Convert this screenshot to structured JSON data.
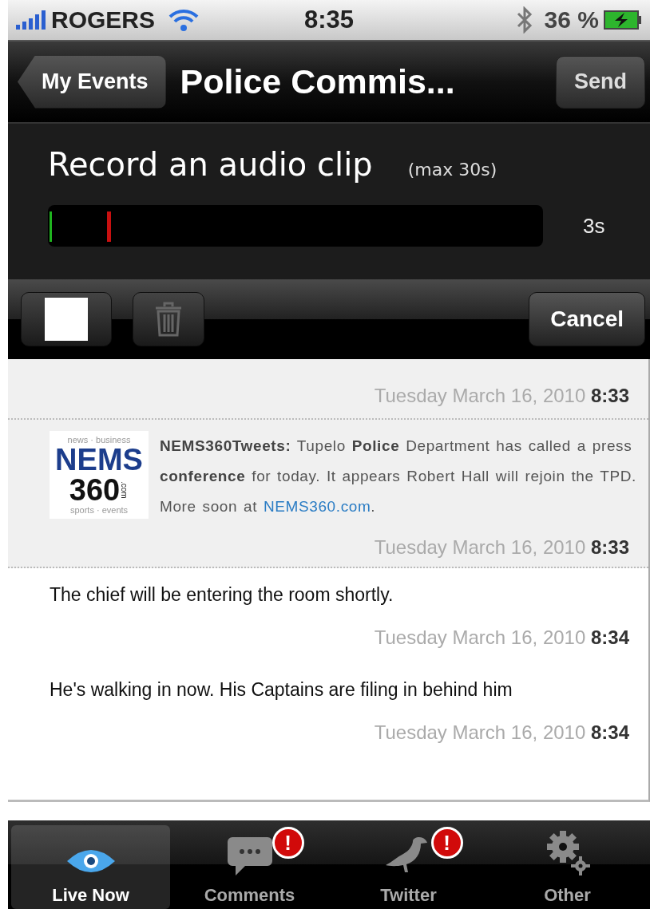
{
  "status_bar": {
    "carrier": "ROGERS",
    "time": "8:35",
    "battery": "36 %"
  },
  "nav_bar": {
    "back": "My Events",
    "title": "Police Commis...",
    "action": "Send"
  },
  "recorder": {
    "title": "Record an audio clip",
    "hint": "(max 30s)",
    "level": 0.12,
    "elapsed": "3s"
  },
  "toolbar": {
    "trash_disabled": true,
    "cancel": "Cancel"
  },
  "feed": [
    {
      "kind": "stub",
      "date": "Tuesday March 16, 2010",
      "time": "8:33"
    },
    {
      "kind": "tweet",
      "logo": {
        "top": "news · business",
        "main": "NEMS",
        "number": "360",
        "suffix": ".com",
        "bottom": "sports · events"
      },
      "text": "**NEMS360Tweets:** Tupelo **Police** Department has called a press **conference** for today. It appears Robert Hall will rejoin the TPD. More soon at ",
      "link": "NEMS360.com",
      "after": ".",
      "date": "Tuesday March 16, 2010",
      "time": "8:33"
    },
    {
      "kind": "text",
      "text": "The chief will be entering the room shortly.",
      "date": "Tuesday March 16, 2010",
      "time": "8:34"
    },
    {
      "kind": "text",
      "text": "He's walking in now. His Captains are filing in behind him",
      "date": "Tuesday March 16, 2010",
      "time": "8:34"
    }
  ],
  "tab_bar": [
    {
      "kind": "eye",
      "label": "Live Now",
      "selected": true
    },
    {
      "kind": "comments",
      "label": "Comments",
      "selected": false,
      "badge": "!"
    },
    {
      "kind": "bird",
      "label": "Twitter",
      "selected": false,
      "badge": "!"
    },
    {
      "kind": "gears",
      "label": "Other",
      "selected": false
    }
  ]
}
